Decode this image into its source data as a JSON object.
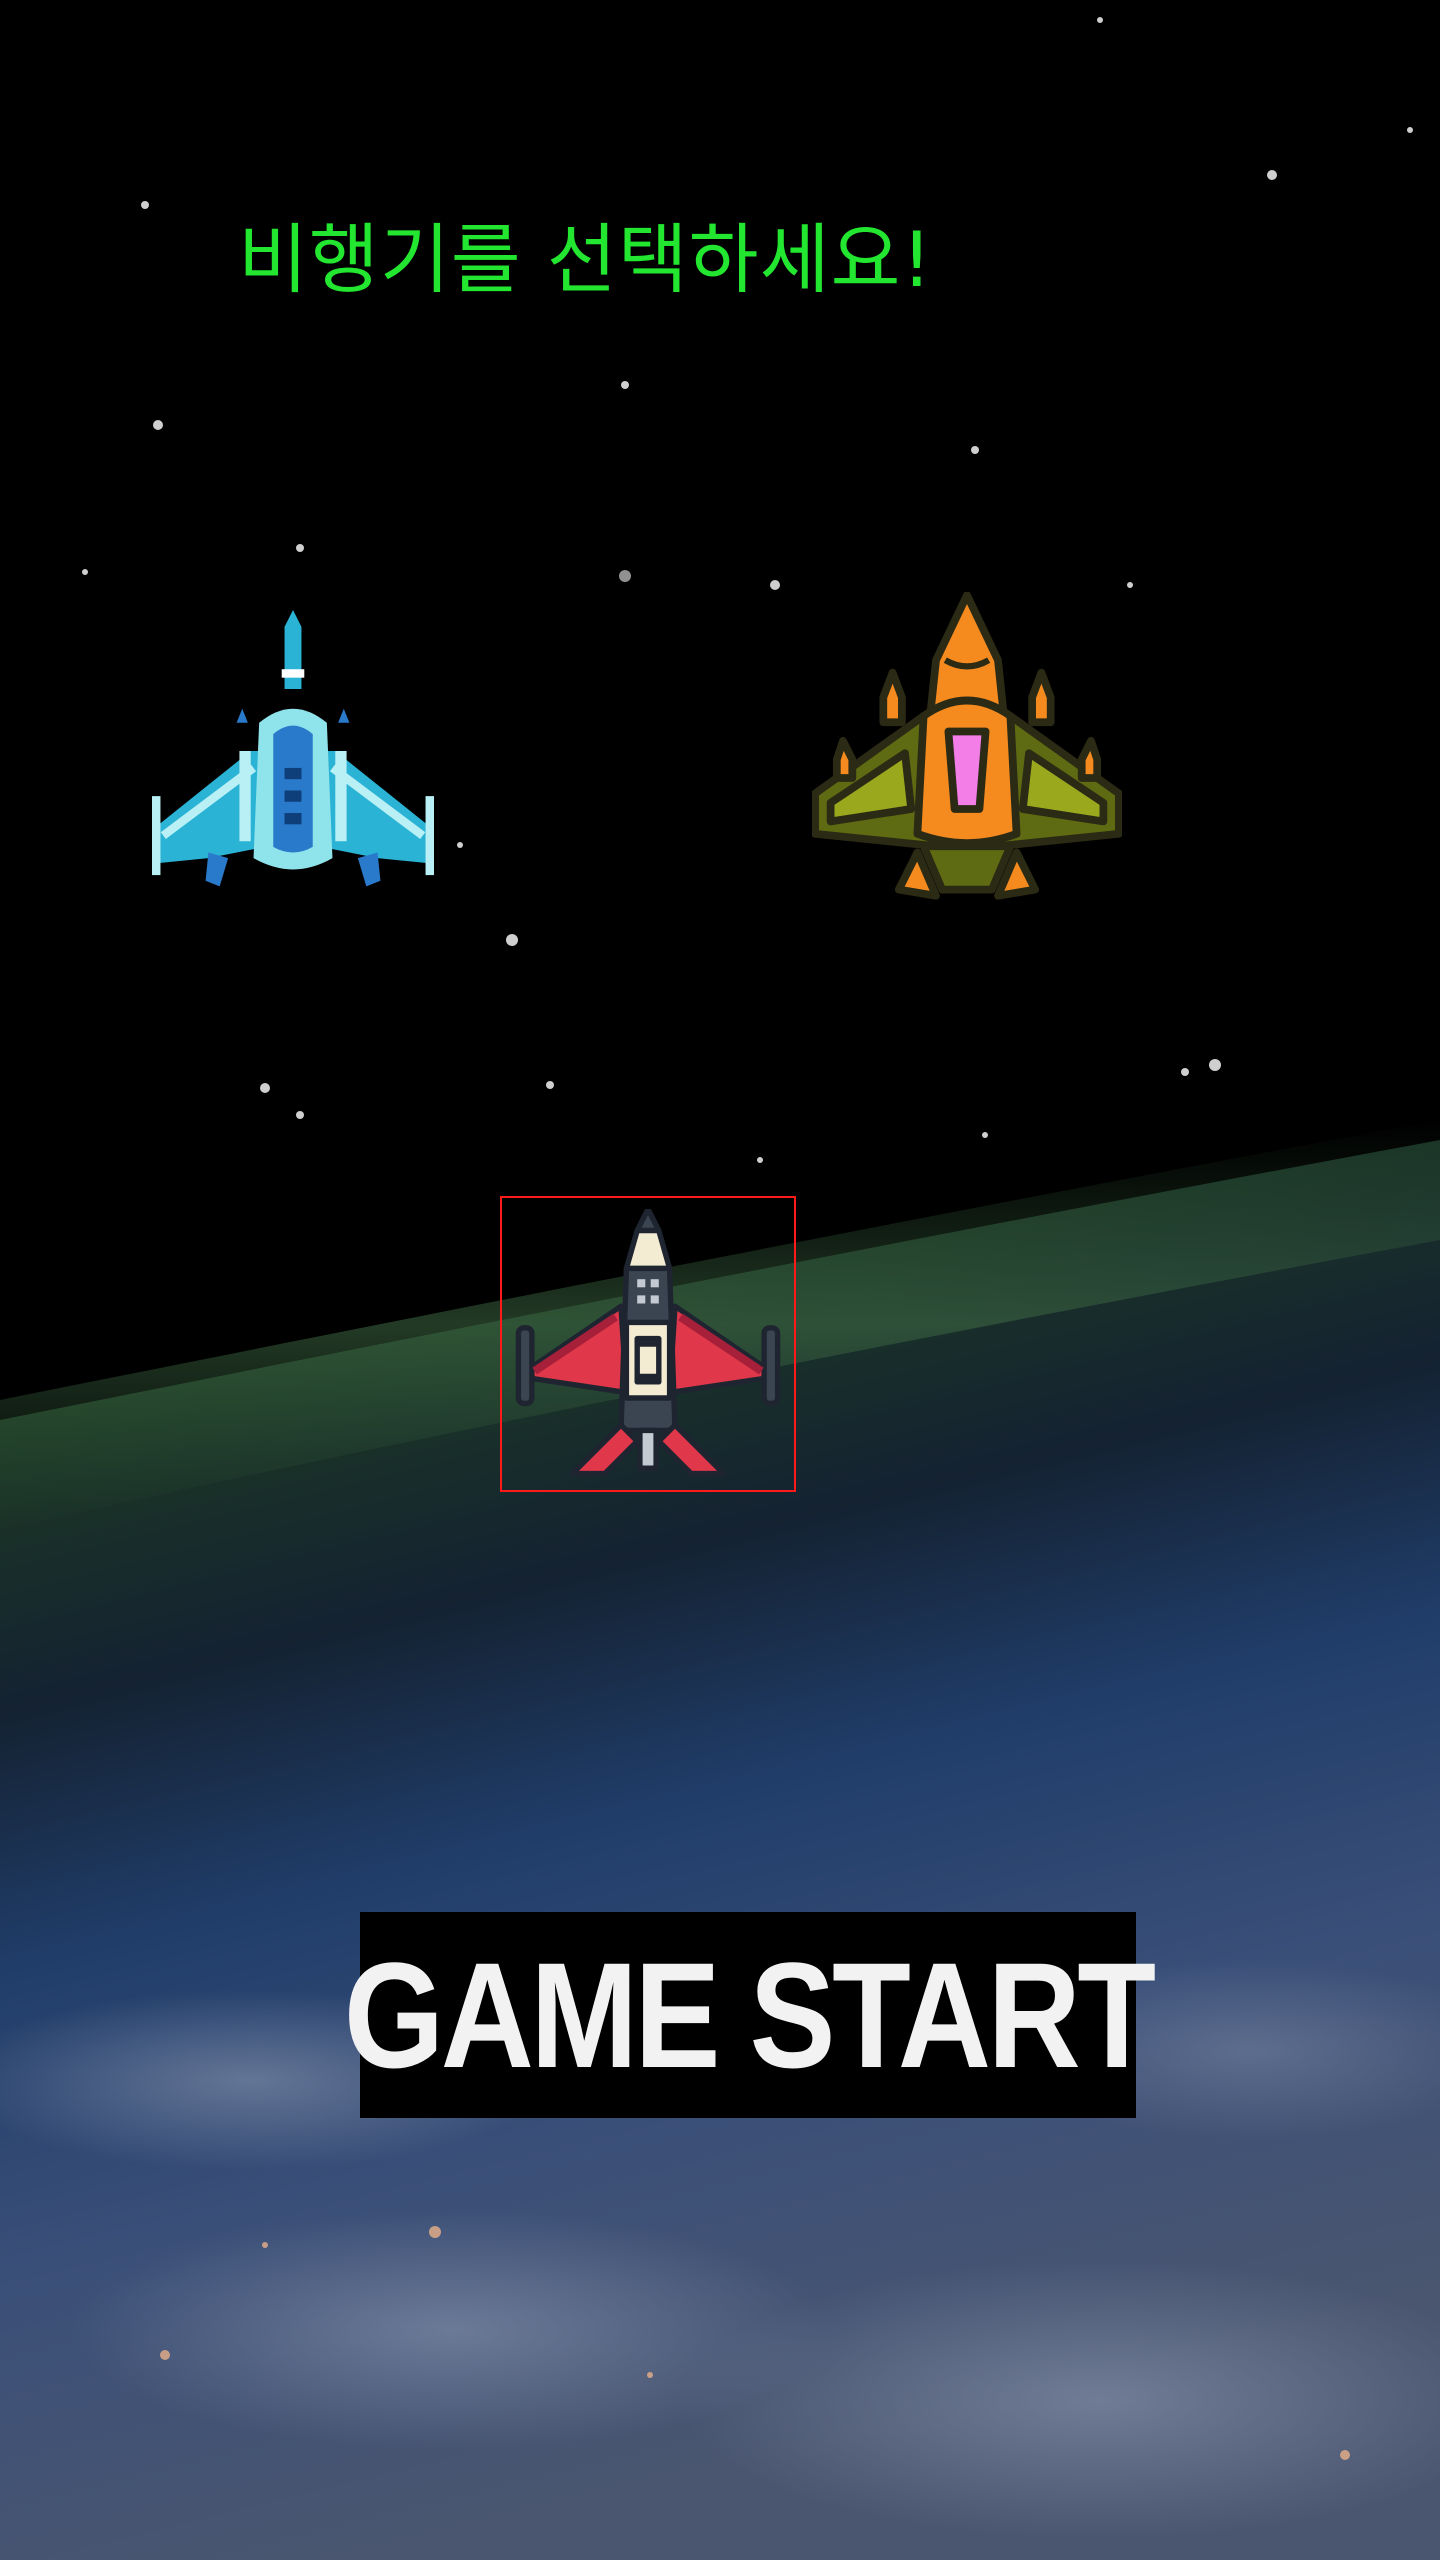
{
  "screen": {
    "title": "비행기를 선택하세요!",
    "title_color": "#22e62f",
    "background": "space-earth-background"
  },
  "planes": [
    {
      "name": "blue-plane",
      "icon": "blue-fighter-jet-icon",
      "primary_color": "#2ab3d4",
      "selected": false
    },
    {
      "name": "orange-plane",
      "icon": "orange-fighter-jet-icon",
      "primary_color": "#f58a1f",
      "selected": false
    },
    {
      "name": "red-plane",
      "icon": "red-fighter-jet-icon",
      "primary_color": "#e0374a",
      "selected": true,
      "selection_color": "#ff1a1a"
    }
  ],
  "start_button": {
    "label": "GAME START"
  }
}
